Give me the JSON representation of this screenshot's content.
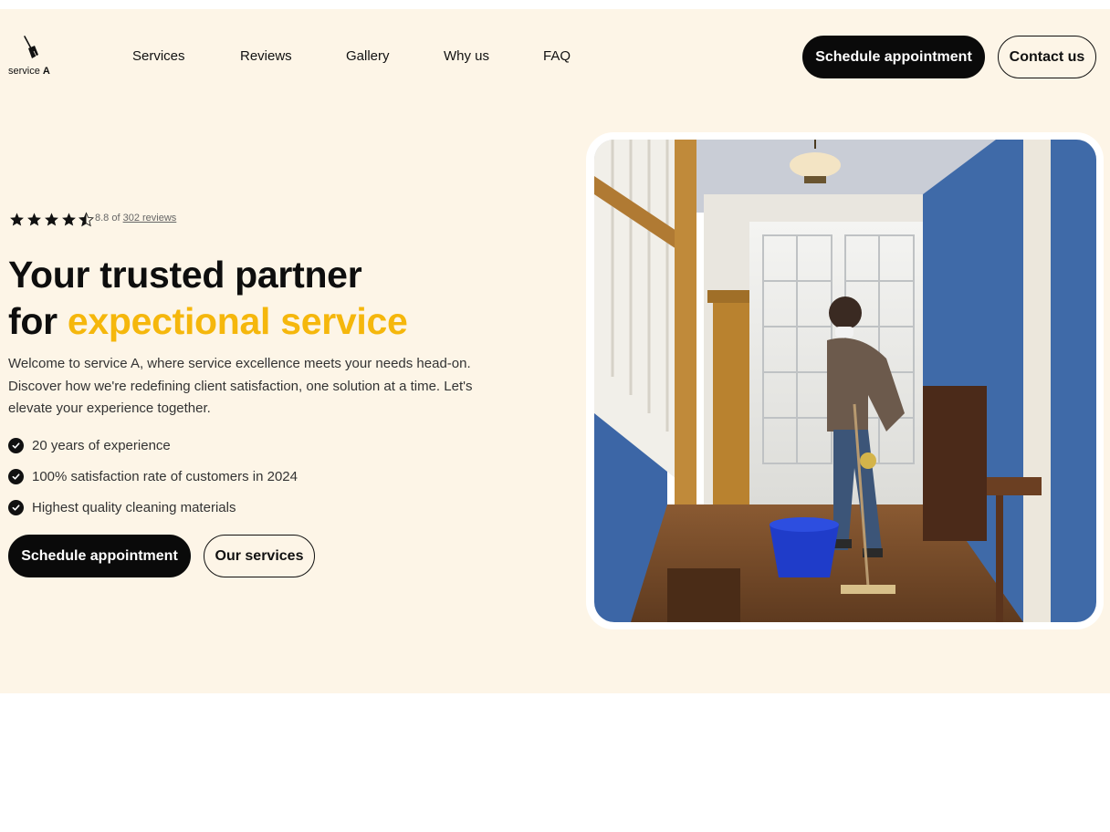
{
  "brand": {
    "logo_text": "service",
    "logo_letter": "A"
  },
  "nav": {
    "items": [
      {
        "label": "Services"
      },
      {
        "label": "Reviews"
      },
      {
        "label": "Gallery"
      },
      {
        "label": "Why us"
      },
      {
        "label": "FAQ"
      }
    ]
  },
  "header_actions": {
    "schedule_label": "Schedule appointment",
    "contact_label": "Contact us"
  },
  "rating": {
    "score_text": "8.8 of",
    "reviews_link": "302 reviews",
    "stars": 4.5
  },
  "hero": {
    "title_line1": "Your trusted partner",
    "title_prefix": "for",
    "title_accent": "expectional service",
    "intro": "Welcome to service A, where service excellence meets your needs head-on. Discover how we're redefining client satisfaction, one solution at a time. Let's elevate your experience together.",
    "features": [
      "20 years of experience",
      "100% satisfaction rate of customers in 2024",
      "Highest quality cleaning materials"
    ],
    "primary_cta": "Schedule appointment",
    "secondary_cta": "Our services"
  },
  "colors": {
    "accent": "#f5b70c",
    "hero_bg": "#fdf5e7",
    "dark": "#0a0a0a"
  },
  "icons": [
    "broom-icon",
    "star-icon",
    "half-star-icon",
    "check-circle-icon"
  ]
}
